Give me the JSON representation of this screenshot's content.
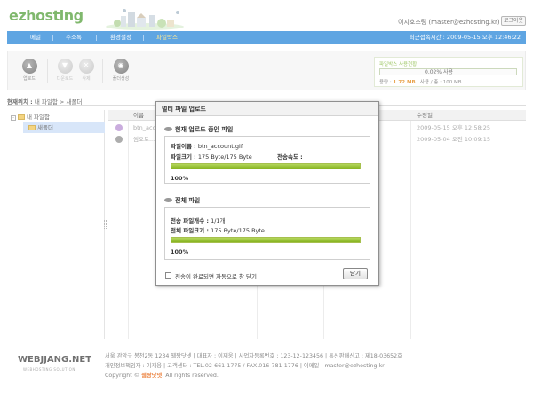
{
  "header": {
    "logo": "ezhosting",
    "user_info": "이지호스팅 (master@ezhosting.kr)",
    "logout_label": "로그아웃"
  },
  "nav": {
    "items": [
      {
        "label": "메일"
      },
      {
        "label": "주소록"
      },
      {
        "label": "환경설정"
      },
      {
        "label": "파일박스"
      }
    ],
    "active_index": 3,
    "last_login": "최근접속시간 : 2009-05-15 오후 12:46:22"
  },
  "toolbar": {
    "buttons": [
      {
        "label": "업로드",
        "icon": "upload-arrow-icon",
        "enabled": true
      },
      {
        "label": "다운로드",
        "icon": "download-arrow-icon",
        "enabled": false
      },
      {
        "label": "삭제",
        "icon": "delete-x-icon",
        "enabled": false
      },
      {
        "label": "폴더생성",
        "icon": "folder-add-icon",
        "enabled": true
      }
    ]
  },
  "usage": {
    "title": "파일박스 사용현황",
    "percent_text": "0.02% 사용",
    "percent": 0.02,
    "detail_used_label": "용량 :",
    "detail_used": "1.72 MB",
    "detail_total": "사용 / 총 : 100 MB"
  },
  "path": {
    "label": "현재위치 :",
    "value": "내 파일함 > 새폴더"
  },
  "tree": {
    "root": "내 파일함",
    "child": "새폴더"
  },
  "table": {
    "headers": {
      "name": "이름",
      "date": "수정일"
    },
    "rows": [
      {
        "name": "btn_acc...",
        "date": "2009-05-15 오후 12:58:25"
      },
      {
        "name": "썸오토...",
        "date": "2009-05-04 오전 10:09:15"
      }
    ]
  },
  "dialog": {
    "title": "멀티 파일 업로드",
    "current": {
      "section_title": "현재 업로드 중인 파일",
      "file_name_label": "파일이름 :",
      "file_name": "btn_account.gif",
      "file_size_label": "파일크기 :",
      "file_size": "175 Byte/175 Byte",
      "speed_label": "전송속도 :",
      "progress": 1.0,
      "percent": "100%"
    },
    "total": {
      "section_title": "전체 파일",
      "count_label": "전송 파일개수 :",
      "count": "1/1개",
      "size_label": "전체 파일크기 :",
      "size": "175 Byte/175 Byte",
      "progress": 1.0,
      "percent": "100%"
    },
    "auto_close_label": "전송이 완료되면 자동으로 창 닫기",
    "close_label": "닫기"
  },
  "footer": {
    "logo": "WEBJJANG.NET",
    "tagline": "WEBHOSTING SOLUTION",
    "line1": "서울 관악구 봉천2동 1234   웹짱닷넷   |   대표자 : 이재웅   |   사업자등록번호 : 123-12-123456   |   통신판매신고 : 제18-03652호",
    "line2": "개인정보책임자 : 이재웅   |   고객센터 : TEL.02-661-1775 / FAX.016-781-1776   |   이메일 : master@ezhosting.kr",
    "copyright_prefix": "Copyright ©",
    "copyright_brand": "웹짱닷넷",
    "copyright_suffix": ". All rights reserved."
  },
  "colors": {
    "nav_bg": "#1a7fd6",
    "nav_active": "#ffe066",
    "logo_green": "#4a9a2e",
    "progress_green": "#86b320",
    "selected_row": "#c8dcf6"
  }
}
